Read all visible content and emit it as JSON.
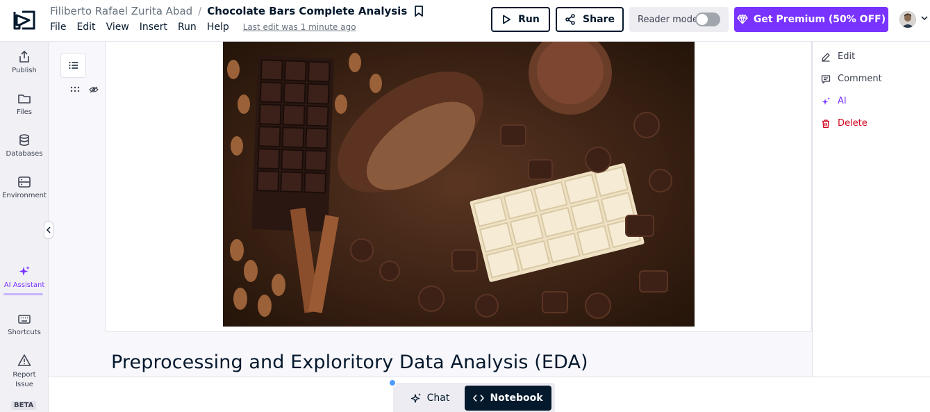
{
  "header": {
    "owner": "Filiberto Rafael Zurita Abad",
    "separator": "/",
    "notebook_title": "Chocolate Bars Complete Analysis",
    "menu": [
      "File",
      "Edit",
      "View",
      "Insert",
      "Run",
      "Help"
    ],
    "last_edit": "Last edit was 1 minute ago",
    "run_label": "Run",
    "share_label": "Share",
    "reader_mode_label": "Reader mode",
    "reader_mode_on": false,
    "premium_label": "Get Premium (50% OFF)"
  },
  "sidebar": {
    "items": [
      {
        "label": "Publish",
        "icon": "publish-icon"
      },
      {
        "label": "Files",
        "icon": "folder-icon"
      },
      {
        "label": "Databases",
        "icon": "database-icon"
      },
      {
        "label": "Environment",
        "icon": "environment-icon"
      },
      {
        "label": "AI Assistant",
        "icon": "sparkle-icon"
      },
      {
        "label": "Shortcuts",
        "icon": "keyboard-icon"
      },
      {
        "label": "Report Issue",
        "icon": "warning-icon"
      }
    ],
    "beta_label": "BETA"
  },
  "cell_actions": {
    "edit": "Edit",
    "comment": "Comment",
    "ai": "AI",
    "delete": "Delete"
  },
  "content": {
    "heading": "Preprocessing and Exploritory Data Analysis (EDA)"
  },
  "dock": {
    "chat_label": "Chat",
    "notebook_label": "Notebook"
  },
  "colors": {
    "brand_dark": "#05192d",
    "accent_purple": "#7933ff",
    "danger": "#d2001c"
  }
}
